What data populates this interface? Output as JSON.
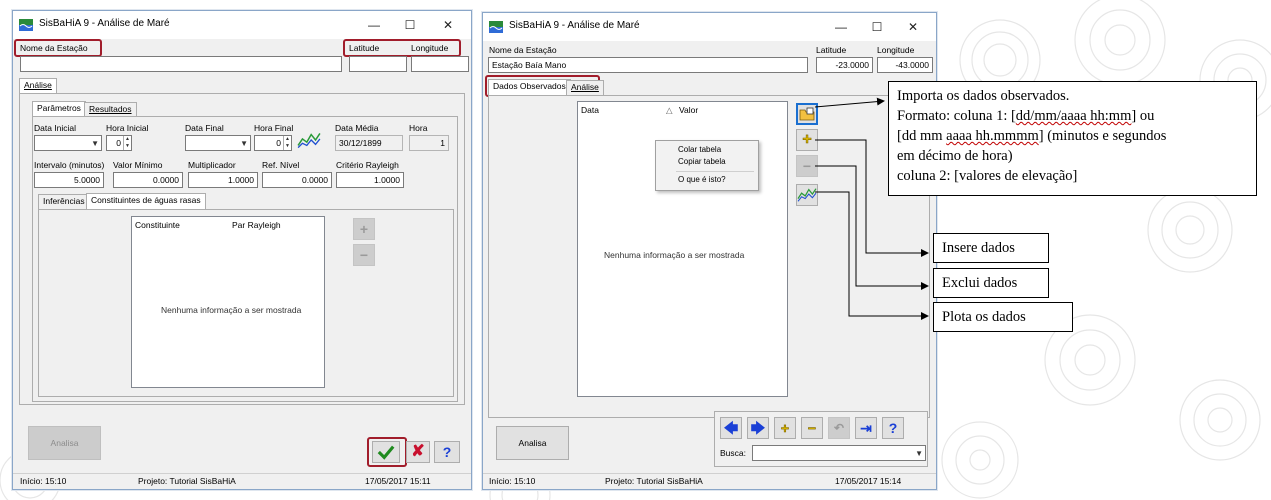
{
  "left_window": {
    "title": "SisBaHiA 9 - Análise de Maré",
    "station_label": "Nome da Estação",
    "station_value": "",
    "latitude_label": "Latitude",
    "longitude_label": "Longitude",
    "latitude_value": "",
    "longitude_value": "",
    "outer_tab": "Análise",
    "inner_tabs": [
      "Parâmetros",
      "Resultados"
    ],
    "params": {
      "data_inicial_label": "Data Inicial",
      "hora_inicial_label": "Hora Inicial",
      "hora_inicial_value": "0",
      "data_final_label": "Data Final",
      "hora_final_label": "Hora Final",
      "hora_final_value": "0",
      "data_media_label": "Data Média",
      "data_media_value": "30/12/1899",
      "hora_label": "Hora",
      "hora_value": "1",
      "intervalo_label": "Intervalo (minutos)",
      "intervalo_value": "5.0000",
      "valor_minimo_label": "Valor Mínimo",
      "valor_minimo_value": "0.0000",
      "multiplicador_label": "Multiplicador",
      "multiplicador_value": "1.0000",
      "ref_nivel_label": "Ref. Nível",
      "ref_nivel_value": "0.0000",
      "criterio_label": "Critério Rayleigh",
      "criterio_value": "1.0000"
    },
    "sub_tabs": [
      "Inferências",
      "Constituintes de águas rasas"
    ],
    "list_columns": [
      "Constituinte",
      "Par Rayleigh"
    ],
    "empty_message": "Nenhuma informação a ser mostrada",
    "analisa_label": "Analisa",
    "status": {
      "inicio": "Início: 15:10",
      "projeto": "Projeto: Tutorial SisBaHiA",
      "datetime": "17/05/2017 15:11"
    }
  },
  "right_window": {
    "title": "SisBaHiA 9 - Análise de Maré",
    "station_label": "Nome da Estação",
    "station_value": "Estação Baía Mano",
    "latitude_label": "Latitude",
    "longitude_label": "Longitude",
    "latitude_value": "-23.0000",
    "longitude_value": "-43.0000",
    "tabs": [
      "Dados Observados",
      "Análise"
    ],
    "list_columns": [
      "Data",
      "Valor"
    ],
    "sort_glyph": "△",
    "empty_message": "Nenhuma informação a ser mostrada",
    "context_menu": [
      "Colar tabela",
      "Copiar tabela",
      "O que é isto?"
    ],
    "analisa_label": "Analisa",
    "busca_label": "Busca:",
    "busca_value": "",
    "status": {
      "inicio": "Início: 15:10",
      "projeto": "Projeto: Tutorial SisBaHiA",
      "datetime": "17/05/2017 15:14"
    }
  },
  "callouts": {
    "importa": {
      "line1": "Importa os dados observados.",
      "line2_pre": "Formato: coluna 1: [",
      "line2_u": "dd/mm/aaaa hh:mm",
      "line2_post": "] ou",
      "line3_pre": "[dd mm ",
      "line3_u": "aaaa hh.mmmm",
      "line3_post": "] (minutos e segundos",
      "line4": "em décimo de hora)",
      "line5": "coluna 2: [valores de elevação]"
    },
    "insere": "Insere dados",
    "exclui": "Exclui dados",
    "plota": "Plota os dados"
  },
  "colors": {
    "annotation_red": "#a11d2b",
    "window_bg": "#f0f0f0",
    "nav_arrow_blue": "#1a3fd6",
    "add_yellow": "#e8c200"
  },
  "icons": {
    "app": "sisbahia-app-icon",
    "import": "import-folder-icon",
    "add": "plus-icon",
    "remove": "minus-icon",
    "plot": "chart-icon",
    "ok": "check-icon",
    "cancel": "x-icon",
    "help": "help-icon"
  }
}
